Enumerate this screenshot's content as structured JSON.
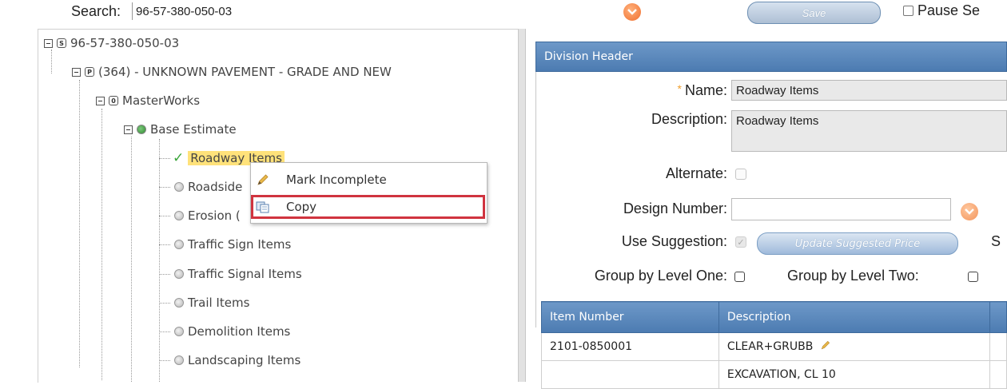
{
  "search": {
    "label": "Search:",
    "value": "96-57-380-050-03"
  },
  "toolbar": {
    "save_label": "Save",
    "pause_label": "Pause Se"
  },
  "tree": {
    "root": {
      "badge": "S",
      "label": "96-57-380-050-03"
    },
    "project": {
      "badge": "P",
      "label": "(364) - UNKNOWN PAVEMENT - GRADE AND NEW"
    },
    "workbook": {
      "badge": "0",
      "label": "MasterWorks"
    },
    "estimate": {
      "label": "Base Estimate"
    },
    "divisions": [
      {
        "label": "Roadway Items",
        "status": "complete"
      },
      {
        "label": "Roadside",
        "status": "incomplete"
      },
      {
        "label": "Erosion (",
        "status": "incomplete"
      },
      {
        "label": "Traffic Sign Items",
        "status": "incomplete"
      },
      {
        "label": "Traffic Signal Items",
        "status": "incomplete"
      },
      {
        "label": "Trail Items",
        "status": "incomplete"
      },
      {
        "label": "Demolition Items",
        "status": "incomplete"
      },
      {
        "label": "Landscaping Items",
        "status": "incomplete"
      }
    ]
  },
  "context_menu": {
    "items": [
      {
        "label": "Mark Incomplete",
        "icon": "pencil-icon"
      },
      {
        "label": "Copy",
        "icon": "copy-icon",
        "highlighted": true
      }
    ]
  },
  "division_header": {
    "title": "Division Header",
    "name_label": "Name:",
    "name_value": "Roadway Items",
    "description_label": "Description:",
    "description_value": "Roadway Items",
    "alternate_label": "Alternate:",
    "design_number_label": "Design Number:",
    "design_number_value": "",
    "use_suggestion_label": "Use Suggestion:",
    "update_price_label": "Update Suggested Price",
    "truncated_label": "S",
    "group_level_one_label": "Group by Level One:",
    "group_level_two_label": "Group by Level Two:"
  },
  "table": {
    "headers": [
      "Item Number",
      "Description"
    ],
    "rows": [
      [
        "2101-0850001",
        "CLEAR+GRUBB"
      ],
      [
        "",
        "EXCAVATION, CL 10"
      ]
    ]
  },
  "colors": {
    "header_blue": "#4c7bb1",
    "highlight_yellow": "#ffe27a",
    "menu_outline_red": "#d0343f",
    "accent_orange": "#f07030"
  }
}
